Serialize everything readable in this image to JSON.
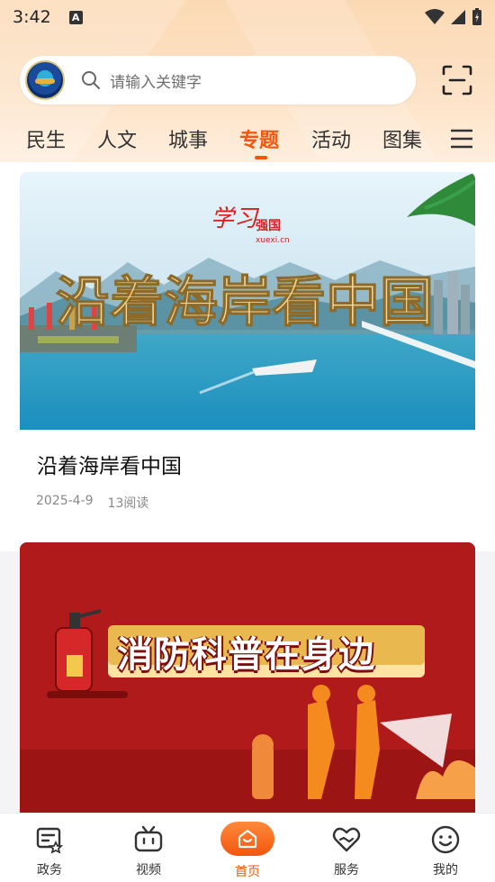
{
  "status_bar": {
    "time": "3:42",
    "notification_badge": "A"
  },
  "search": {
    "placeholder": "请输入关键字"
  },
  "tabs": [
    {
      "label": "民生",
      "active": false
    },
    {
      "label": "人文",
      "active": false
    },
    {
      "label": "城事",
      "active": false
    },
    {
      "label": "专题",
      "active": true
    },
    {
      "label": "活动",
      "active": false
    },
    {
      "label": "图集",
      "active": false
    }
  ],
  "articles": [
    {
      "title": "沿着海岸看中国",
      "date": "2025-4-9",
      "reads": "13阅读",
      "banner_text": "沿着海岸看中国",
      "banner_brand": "学习强国",
      "banner_brand_url": "xuexi.cn"
    },
    {
      "banner_text": "消防科普在身边"
    }
  ],
  "bottom_nav": [
    {
      "label": "政务",
      "icon": "gov-affairs-icon"
    },
    {
      "label": "视频",
      "icon": "video-tv-icon"
    },
    {
      "label": "首页",
      "icon": "home-icon",
      "active": true
    },
    {
      "label": "服务",
      "icon": "service-heart-icon"
    },
    {
      "label": "我的",
      "icon": "smile-face-icon"
    }
  ],
  "colors": {
    "accent": "#f2560d",
    "header_bg": "#fbd9b4",
    "card2_bg": "#b01a1a"
  }
}
